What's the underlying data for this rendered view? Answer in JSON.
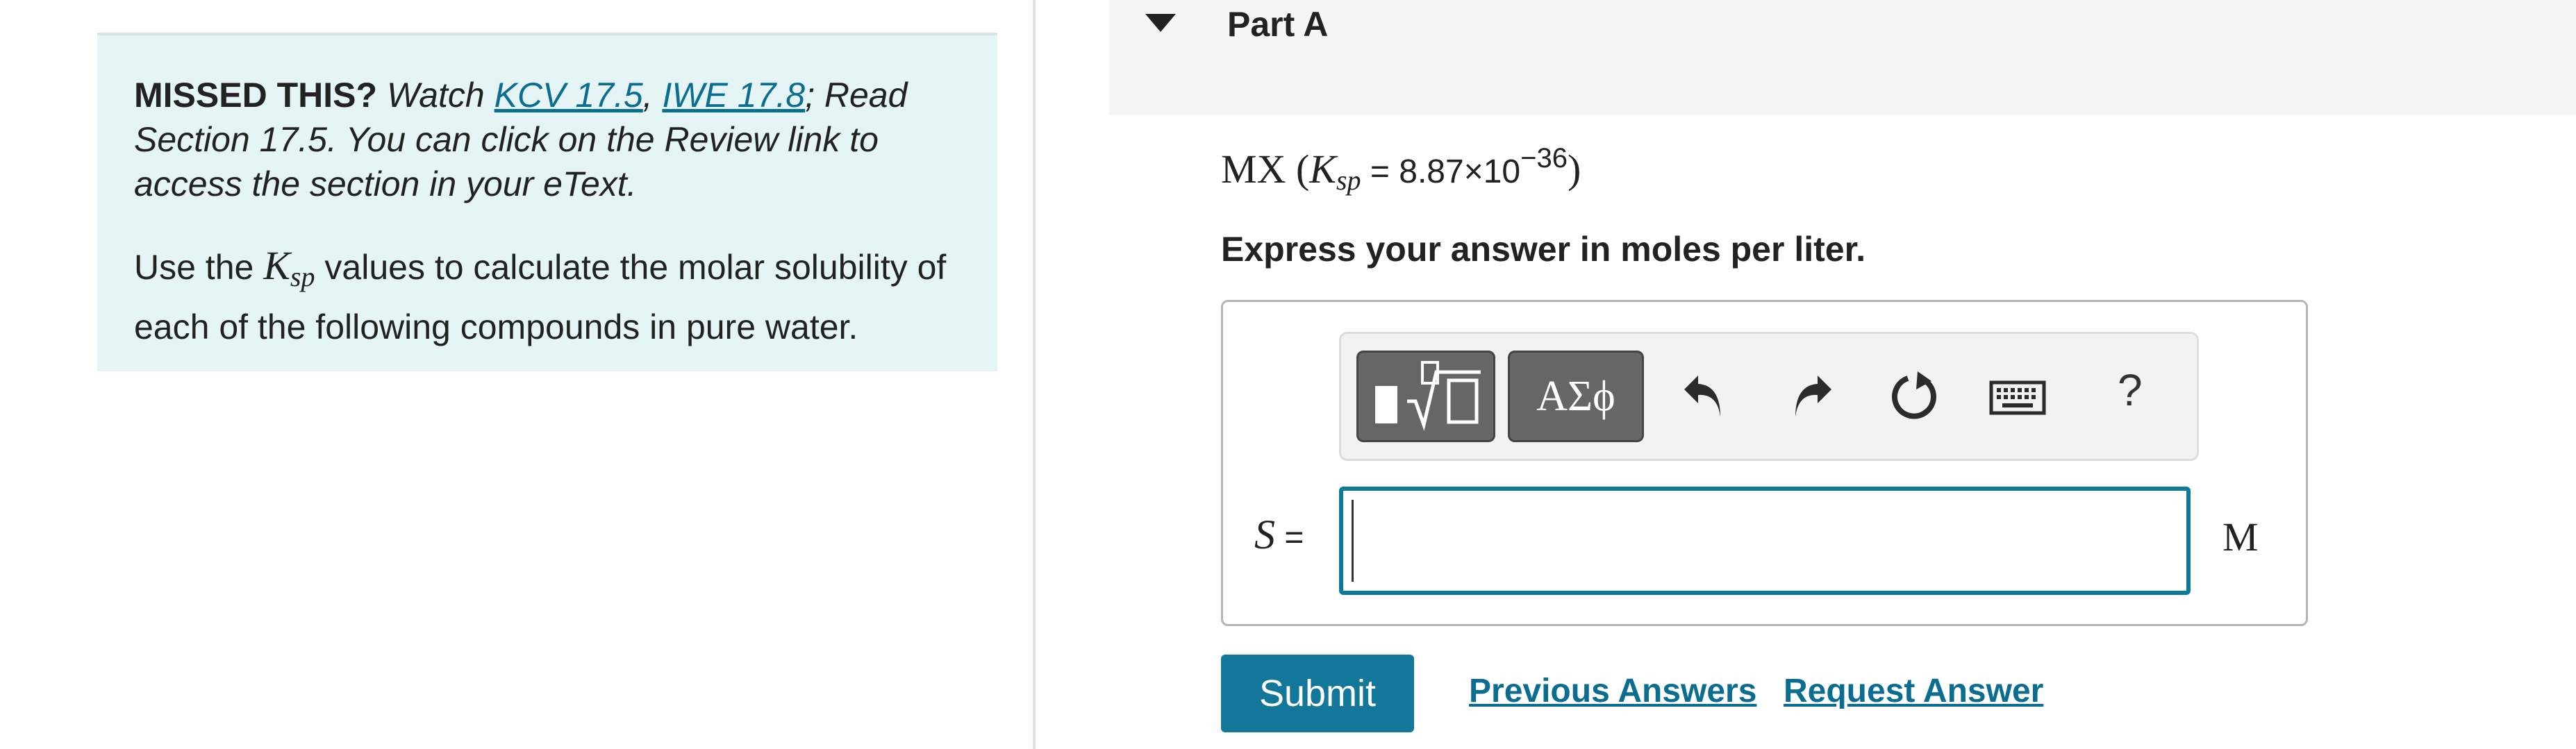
{
  "hint": {
    "missed_label": "MISSED THIS?",
    "watch_text": "Watch",
    "link_kcv": "KCV 17.5",
    "comma": ",",
    "link_iwe": "IWE 17.8",
    "read_text": "; Read Section 17.5. You can click on the Review link to access the section in your eText.",
    "body_prefix": "Use the",
    "k_symbol": "K",
    "k_sub": "sp",
    "body_suffix": "values to calculate the molar solubility of each of the following compounds in pure water."
  },
  "part": {
    "title": "Part A"
  },
  "question": {
    "compound": "MX",
    "open_paren": "(",
    "k_symbol": "K",
    "k_sub": "sp",
    "equals_value": " = 8.87×10",
    "exponent": "−36",
    "close_paren": ")",
    "instruction": "Express your answer in moles per liter."
  },
  "toolbar": {
    "symbols_label": "ΑΣϕ",
    "help_label": "?",
    "icons": [
      "templates-icon",
      "undo-icon",
      "redo-icon",
      "reset-icon",
      "keyboard-icon",
      "help-icon"
    ]
  },
  "answer": {
    "variable": "S",
    "equals": " =",
    "value": "",
    "unit": "M"
  },
  "actions": {
    "submit_label": "Submit",
    "previous_answers_label": "Previous Answers",
    "request_answer_label": "Request Answer"
  },
  "colors": {
    "accent": "#13779a",
    "link": "#0b6e91",
    "hint_background": "#e5f4f5"
  }
}
